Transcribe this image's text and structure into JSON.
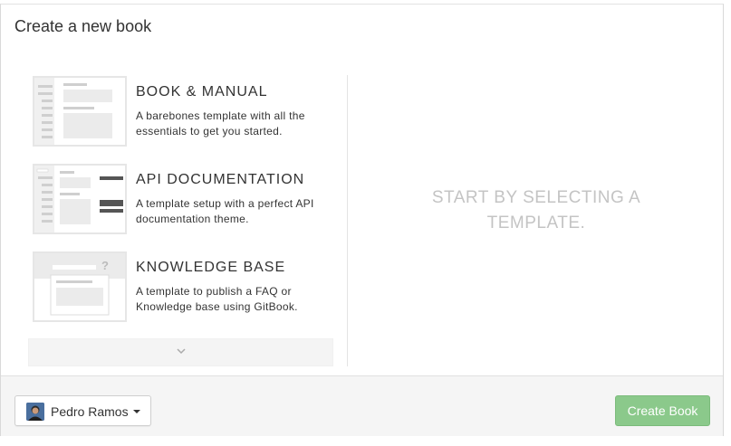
{
  "dialog": {
    "title": "Create a new book"
  },
  "templates": [
    {
      "name": "BOOK & MANUAL",
      "description": "A barebones template with all the essentials to get you started.",
      "icon": "book-manual-thumbnail-icon"
    },
    {
      "name": "API DOCUMENTATION",
      "description": "A template setup with a perfect API documentation theme.",
      "icon": "api-documentation-thumbnail-icon"
    },
    {
      "name": "KNOWLEDGE BASE",
      "description": "A template to publish a FAQ or Knowledge base using GitBook.",
      "icon": "knowledge-base-thumbnail-icon"
    }
  ],
  "more_button": {
    "icon": "chevron-down-icon"
  },
  "preview": {
    "placeholder": "START BY SELECTING A TEMPLATE."
  },
  "footer": {
    "user_name": "Pedro Ramos",
    "create_label": "Create Book"
  },
  "colors": {
    "create_button": "#8bc98b",
    "placeholder_text": "#c4c4c4",
    "footer_bg": "#f5f5f5"
  }
}
